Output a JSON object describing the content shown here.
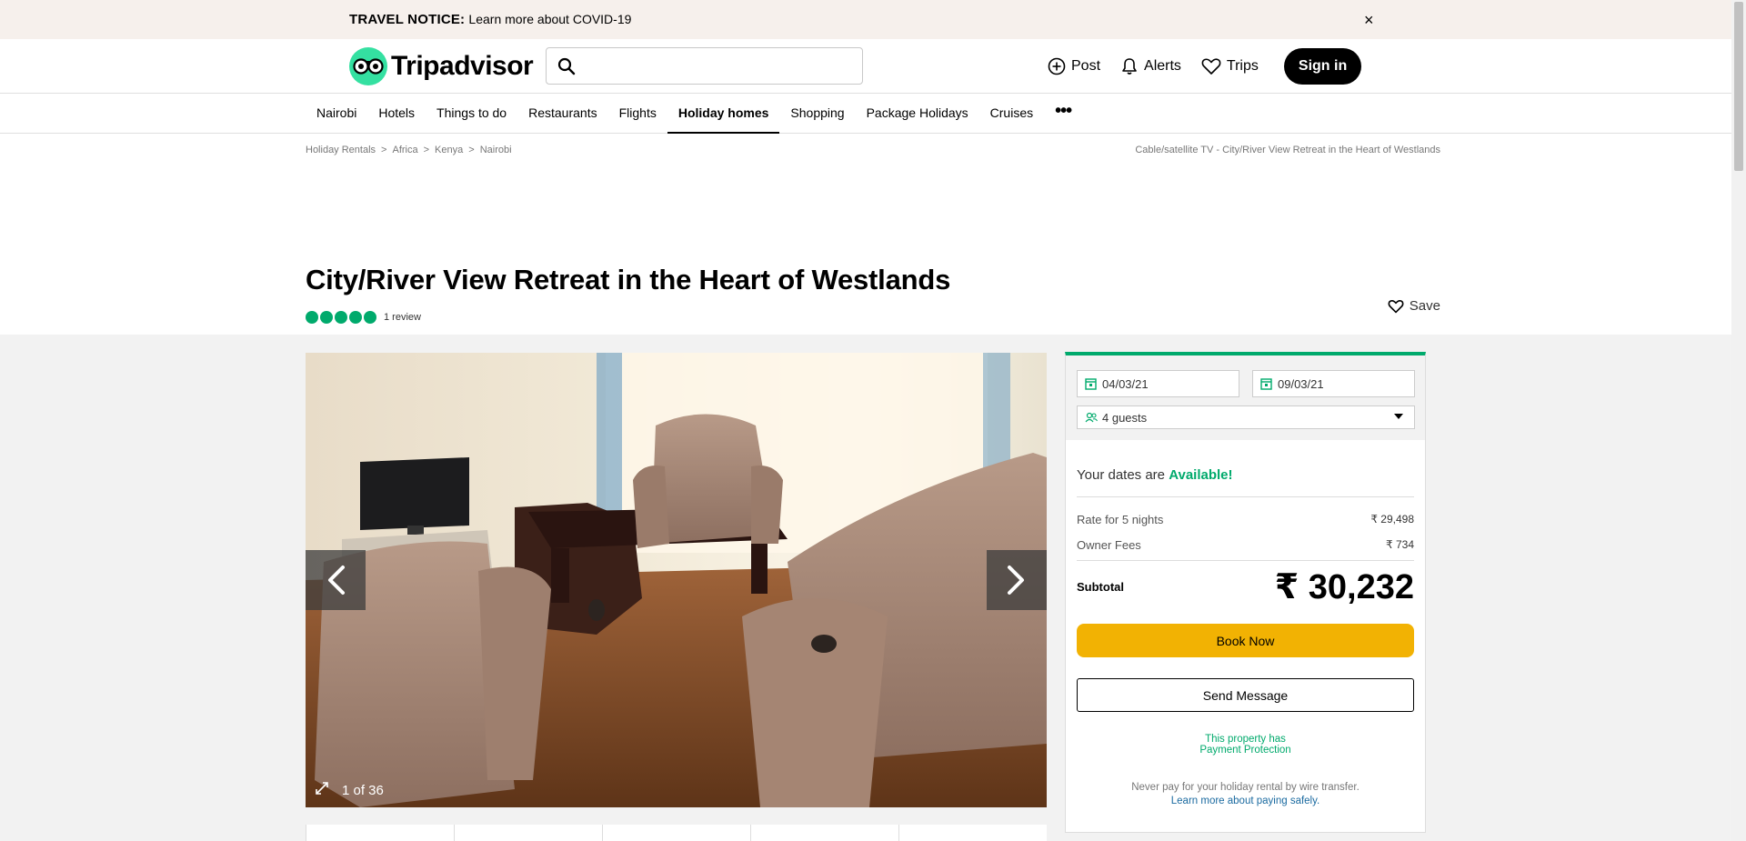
{
  "notice": {
    "label": "TRAVEL NOTICE:",
    "link": "Learn more about COVID-19",
    "close": "×"
  },
  "header": {
    "logo": "Tripadvisor",
    "search_placeholder": "",
    "nav": {
      "post": "Post",
      "alerts": "Alerts",
      "trips": "Trips",
      "signin": "Sign in"
    }
  },
  "tabs": [
    {
      "label": "Nairobi"
    },
    {
      "label": "Hotels"
    },
    {
      "label": "Things to do"
    },
    {
      "label": "Restaurants"
    },
    {
      "label": "Flights"
    },
    {
      "label": "Holiday homes",
      "active": true
    },
    {
      "label": "Shopping"
    },
    {
      "label": "Package Holidays"
    },
    {
      "label": "Cruises"
    }
  ],
  "tabs_more": "•••",
  "breadcrumb": [
    "Holiday Rentals",
    "Africa",
    "Kenya",
    "Nairobi"
  ],
  "breadcrumb_sep": ">",
  "breadcrumb_right": "Cable/satellite TV - City/River View Retreat in the Heart of Westlands",
  "listing": {
    "title": "City/River View Retreat in the Heart of Westlands",
    "rating_bubbles": 5,
    "reviews": "1 review",
    "save": "Save"
  },
  "gallery": {
    "counter": "1 of 36",
    "current": 1,
    "total": 36
  },
  "booking": {
    "checkin": "04/03/21",
    "checkout": "09/03/21",
    "guests": "4 guests",
    "avail_prefix": "Your dates are",
    "avail_status": "Available!",
    "rate_label": "Rate for 5 nights",
    "rate_value": "₹ 29,498",
    "fees_label": "Owner Fees",
    "fees_value": "₹ 734",
    "subtotal_label": "Subtotal",
    "subtotal_value": "₹ 30,232",
    "book_now": "Book Now",
    "send_message": "Send Message",
    "protect_line1": "This property has",
    "protect_line2": "Payment Protection",
    "wire_text": "Never pay for your holiday rental by wire transfer.",
    "wire_link": "Learn more about paying safely."
  },
  "colors": {
    "brand_green": "#00aa6c",
    "logo_green": "#34e0a1",
    "book_yellow": "#f2b203",
    "notice_bg": "#f6f0ec"
  }
}
